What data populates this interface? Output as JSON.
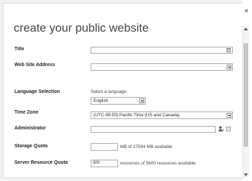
{
  "dialog": {
    "title": "create your public website",
    "close_label": "×"
  },
  "fields": {
    "title": {
      "label": "Title",
      "value": ""
    },
    "address": {
      "label": "Web Site Address",
      "value": ""
    },
    "language": {
      "label": "Language Selection",
      "hint": "Select a language:",
      "selected": "English"
    },
    "timezone": {
      "label": "Time Zone",
      "selected": "(UTC-08:00) Pacific Time (US and Canada)"
    },
    "administrator": {
      "label": "Administrator",
      "value": ""
    },
    "storage": {
      "label": "Storage Quota",
      "value": "",
      "suffix": "MB of 27594 MB available"
    },
    "resource": {
      "label": "Server Resource Quota",
      "value": "300",
      "suffix": "resources of 5600 resources available"
    }
  },
  "icons": {
    "close": "close-icon",
    "title_field": "text-format-icon",
    "people": "check-names-icon",
    "browse": "address-book-icon"
  }
}
